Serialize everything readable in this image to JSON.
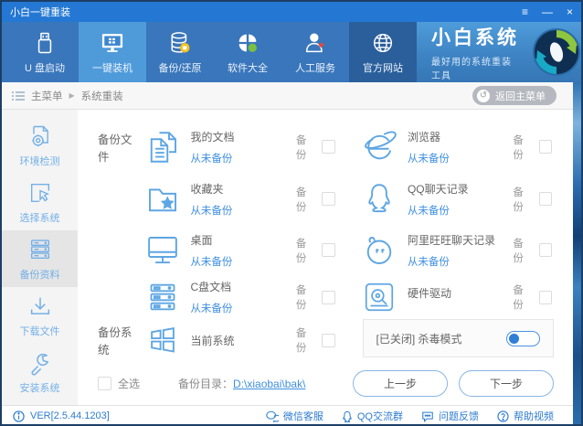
{
  "window": {
    "title": "小白一键重装",
    "controls": {
      "menu": "≡",
      "minimize": "—",
      "close": "×"
    }
  },
  "nav": {
    "items": [
      {
        "label": "U 盘启动"
      },
      {
        "label": "一键装机"
      },
      {
        "label": "备份/还原"
      },
      {
        "label": "软件大全"
      },
      {
        "label": "人工服务"
      },
      {
        "label": "官方网站"
      }
    ],
    "brand": {
      "title": "小白系统",
      "subtitle": "最好用的系统重装工具"
    }
  },
  "breadcrumb": {
    "root": "主菜单",
    "separator": "▶",
    "current": "系统重装",
    "back_button": "返回主菜单",
    "back_icon": "↺"
  },
  "sidebar": {
    "items": [
      {
        "label": "环境检测"
      },
      {
        "label": "选择系统"
      },
      {
        "label": "备份资料"
      },
      {
        "label": "下载文件"
      },
      {
        "label": "安装系统"
      }
    ]
  },
  "backup": {
    "files_section_label": "备份文件",
    "system_section_label": "备份系统",
    "backup_label": "备份",
    "files": [
      {
        "title": "我的文档",
        "status": "从未备份"
      },
      {
        "title": "收藏夹",
        "status": "从未备份"
      },
      {
        "title": "桌面",
        "status": "从未备份"
      },
      {
        "title": "C盘文档",
        "status": "从未备份"
      },
      {
        "title": "浏览器",
        "status": "从未备份"
      },
      {
        "title": "QQ聊天记录",
        "status": "从未备份"
      },
      {
        "title": "阿里旺旺聊天记录",
        "status": "从未备份"
      },
      {
        "title": "硬件驱动",
        "status": ""
      }
    ],
    "system_item": {
      "title": "当前系统"
    },
    "antivirus": {
      "label": "[已关闭] 杀毒模式"
    },
    "select_all": "全选",
    "dir_label": "备份目录：",
    "dir_path": "D:\\xiaobai\\bak\\",
    "prev_button": "上一步",
    "next_button": "下一步"
  },
  "statusbar": {
    "version": "VER[2.5.44.1203]",
    "links": [
      {
        "label": "微信客服"
      },
      {
        "label": "QQ交流群"
      },
      {
        "label": "问题反馈"
      },
      {
        "label": "帮助视频"
      }
    ]
  },
  "colors": {
    "titlebar": "#2478d3",
    "navbar": "#3a76bb",
    "nav_selected": "#4f9bda",
    "nav_dark": "#2b5f9b",
    "accent_blue": "#3f8fe0",
    "sidebar_icon": "#74b0e7",
    "item_icon": "#5ea6e3",
    "green_leaf": "#7ac143",
    "coin_yellow": "#f2c222",
    "heart_red": "#e8463c"
  }
}
